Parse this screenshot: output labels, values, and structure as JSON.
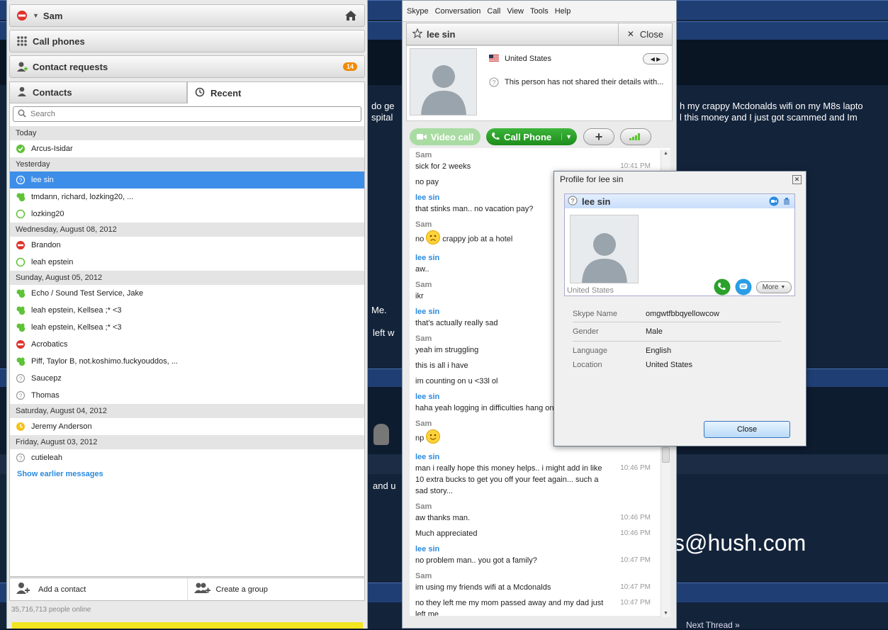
{
  "background": {
    "line1_left": "do ge",
    "line1_right": "h my crappy Mcdonalds wifi on my M8s lapto",
    "line2_left": "spital",
    "line2_right": "l this money and I just got scammed and Im",
    "me": "Me.",
    "left": "left w",
    "and": "and u",
    "email": "s@hush.com",
    "next_thread": "Next Thread »"
  },
  "main": {
    "user": "Sam",
    "call_phones": "Call phones",
    "contact_requests": "Contact requests",
    "requests_count": "14",
    "tab_contacts": "Contacts",
    "tab_recent": "Recent",
    "search_placeholder": "Search",
    "groups": [
      {
        "label": "Today",
        "rows": [
          {
            "name": "Arcus-Isidar",
            "status": "online"
          }
        ]
      },
      {
        "label": "Yesterday",
        "rows": [
          {
            "name": "lee sin",
            "status": "unknown",
            "selected": true
          },
          {
            "name": "tmdann, richard, lozking20, ...",
            "status": "group"
          },
          {
            "name": "lozking20",
            "status": "offline"
          }
        ]
      },
      {
        "label": "Wednesday, August 08, 2012",
        "rows": [
          {
            "name": "Brandon",
            "status": "busy"
          },
          {
            "name": "leah epstein",
            "status": "offline"
          }
        ]
      },
      {
        "label": "Sunday, August 05, 2012",
        "rows": [
          {
            "name": "Echo / Sound Test Service, Jake",
            "status": "group"
          },
          {
            "name": "leah epstein, Kellsea ;* <3",
            "status": "group"
          },
          {
            "name": "leah epstein, Kellsea ;* <3",
            "status": "group"
          },
          {
            "name": "Acrobatics",
            "status": "busy"
          },
          {
            "name": "Piff, Taylor B, not.koshimo.fuckyouddos, ...",
            "status": "group"
          },
          {
            "name": "Saucepz",
            "status": "unknown"
          },
          {
            "name": "Thomas",
            "status": "unknown"
          }
        ]
      },
      {
        "label": "Saturday, August 04, 2012",
        "rows": [
          {
            "name": "Jeremy Anderson",
            "status": "away"
          }
        ]
      },
      {
        "label": "Friday, August 03, 2012",
        "rows": [
          {
            "name": "cutieleah",
            "status": "unknown"
          }
        ]
      }
    ],
    "show_earlier": "Show earlier messages",
    "add_contact": "Add a contact",
    "create_group": "Create a group",
    "online_count": "35,716,713 people online",
    "status_colors": {
      "online": "#5ec336",
      "busy": "#e0322b",
      "away": "#f4c21a",
      "offline": "#5ec336",
      "unknown": "#9a9a9a",
      "group": "#5ec336",
      "selected": "#ffffff"
    }
  },
  "conv": {
    "menu": [
      "Skype",
      "Conversation",
      "Call",
      "View",
      "Tools",
      "Help"
    ],
    "contact_name": "lee sin",
    "close_label": "Close",
    "country": "United States",
    "details": "This person has not shared their details with...",
    "video_call": "Video call",
    "call_phone": "Call Phone",
    "messages": [
      {
        "author": "Sam",
        "text": "sick for 2 weeks",
        "time": "10:41 PM"
      },
      {
        "text": "no pay"
      },
      {
        "author": "lee sin",
        "text": "that stinks man.. no vacation pay?"
      },
      {
        "author": "Sam",
        "text": "crappy job at a hotel",
        "prefix": "no",
        "emoji": "sad"
      },
      {
        "author": "lee sin",
        "text": "aw.."
      },
      {
        "author": "Sam",
        "text": "ikr"
      },
      {
        "author": "lee sin",
        "text": "that's actually really sad"
      },
      {
        "author": "Sam",
        "text": "yeah  im struggling"
      },
      {
        "text": "this is all i have"
      },
      {
        "text": "im counting on u <33l ol"
      },
      {
        "author": "lee sin",
        "text": "haha yeah logging in difficulties hang on"
      },
      {
        "author": "Sam",
        "text": "",
        "prefix": "np",
        "emoji": "smile"
      },
      {
        "author": "lee sin",
        "text": "man i really hope this money helps.. i might add in like 10 extra bucks to get you off your feet again... such a sad story...",
        "time": "10:46 PM"
      },
      {
        "author": "Sam",
        "text": "aw thanks man.",
        "time": "10:46 PM"
      },
      {
        "text": "Much appreciated",
        "time": "10:46 PM"
      },
      {
        "author": "lee sin",
        "text": "no problem man.. you got a family?",
        "time": "10:47 PM"
      },
      {
        "author": "Sam",
        "text": "im using my friends wifi at a Mcdonalds",
        "time": "10:47 PM"
      },
      {
        "text": "no they left me my mom passed away and my dad just left me",
        "time": "10:47 PM"
      }
    ]
  },
  "popup": {
    "title": "Profile for lee sin",
    "name": "lee sin",
    "country": "United States",
    "more": "More",
    "fields": [
      {
        "k": "Skype Name",
        "v": "omgwtfbbqyellowcow"
      },
      {
        "k": "Gender",
        "v": "Male"
      },
      {
        "k": "Language",
        "v": "English"
      },
      {
        "k": "Location",
        "v": "United States"
      }
    ],
    "close": "Close"
  }
}
